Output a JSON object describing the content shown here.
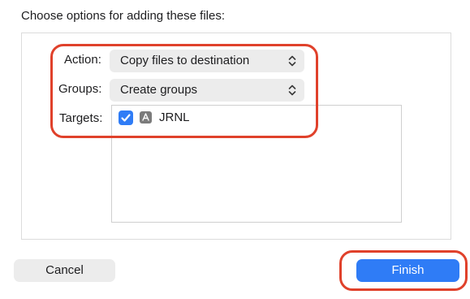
{
  "dialog": {
    "heading": "Choose options for adding these files:"
  },
  "options": {
    "action": {
      "label": "Action:",
      "value": "Copy files to destination"
    },
    "groups": {
      "label": "Groups:",
      "value": "Create groups"
    },
    "targets": {
      "label": "Targets:",
      "items": [
        {
          "name": "JRNL",
          "checked": true,
          "icon": "app-target-icon"
        }
      ]
    }
  },
  "buttons": {
    "cancel": "Cancel",
    "finish": "Finish"
  },
  "colors": {
    "accent": "#2f7cf6",
    "highlight": "#e0412b",
    "popup_bg": "#ececec"
  }
}
